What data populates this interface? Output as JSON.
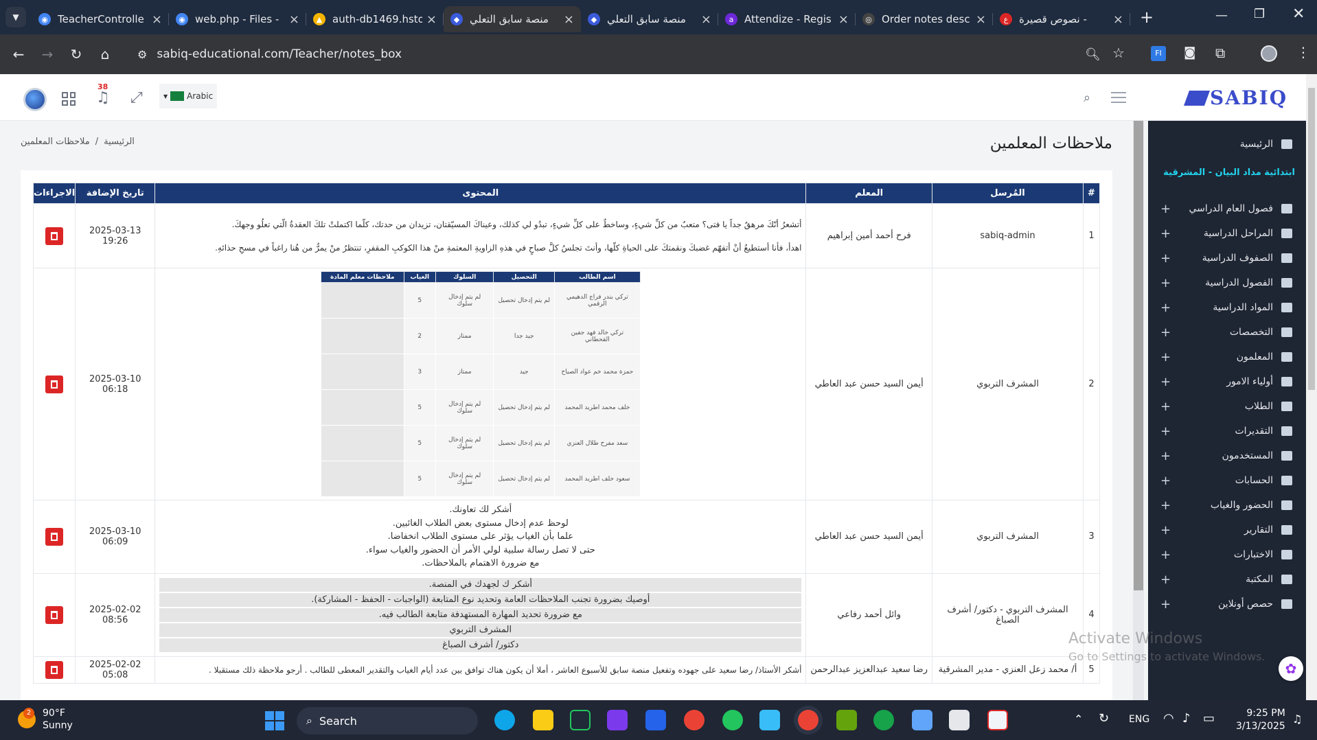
{
  "browser": {
    "tabs": [
      {
        "title": "TeacherControlle",
        "color": "#4285f4",
        "glyph": "◉"
      },
      {
        "title": "web.php - Files -",
        "color": "#4285f4",
        "glyph": "◉"
      },
      {
        "title": "auth-db1469.hsto",
        "color": "#f4b400",
        "glyph": "▲"
      },
      {
        "title": "منصة سابق التعلي",
        "color": "#3b5bdb",
        "glyph": "◆",
        "active": true
      },
      {
        "title": "منصة سابق التعلي",
        "color": "#3b5bdb",
        "glyph": "◆"
      },
      {
        "title": "Attendize - Regis",
        "color": "#6d28d9",
        "glyph": "a"
      },
      {
        "title": "Order notes desc",
        "color": "#444",
        "glyph": "◎"
      },
      {
        "title": "نصوص قصيرة -",
        "color": "#dc2626",
        "glyph": "ع"
      }
    ],
    "url": "sabiq-educational.com/Teacher/notes_box"
  },
  "header": {
    "notif_count": "38",
    "lang": "Arabic",
    "logo": "SABIQ"
  },
  "breadcrumb": {
    "home": "الرئيسية",
    "sep": "/",
    "current": "ملاحظات المعلمين"
  },
  "page_title": "ملاحظات المعلمين",
  "sidebar": {
    "home": "الرئيسية",
    "school": "ابتدائية مداد البيان - المشرقية",
    "items": [
      "فصول العام الدراسي",
      "المراحل الدراسية",
      "الصفوف الدراسية",
      "الفصول الدراسية",
      "المواد الدراسية",
      "التخصصات",
      "المعلمون",
      "أولياء الامور",
      "الطلاب",
      "التقديرات",
      "المستخدمون",
      "الحسابات",
      "الحضور والغياب",
      "التقارير",
      "الاختبارات",
      "المكتبة",
      "حصص أونلاين"
    ]
  },
  "table": {
    "headers": {
      "num": "#",
      "sender": "المُرسل",
      "teacher": "المعلم",
      "content": "المحتوى",
      "date": "تاريخ الإضافة",
      "actions": "الاجراءات"
    },
    "rows": [
      {
        "num": "1",
        "sender": "sabiq-admin",
        "teacher": "فرح أحمد أمين إبراهيم",
        "content_lines": [
          "أتشعرُ أنّكَ مرهقٌ جداً يا فتى؟ متعبٌ من كلِّ شيءٍ، وساخطٌ على كلِّ شيءٍ، تبدُو لي كذلك، وعيناكَ المسيّقتان، تزيدان من حدتك، كلّما اكتملتْ تلكَ العقدةُ الّتي تعلُو وجهكَ.",
          "اهدأ، فأنا أستطيعُ أنْ أتفهّم غضبكَ ونقمتكَ على الحياةِ كلّها، وأنتَ تجلسُ كلَّ صباحٍ في هذهِ الزاويةِ المعتمةِ منْ هذا الكوكبِ المقفرِ، تنتظرُ منْ يمرُّ من هُنا راغباً في مسحِ حذائهِ."
        ],
        "date": "2025-03-13 19:26"
      },
      {
        "num": "2",
        "sender": "المشرف التربوي",
        "teacher": "أيمن السيد حسن عبد العاطي",
        "mini_headers": [
          "اسم الطالب",
          "التحصيل",
          "السلوك",
          "الغياب",
          "ملاحظات معلم المادة"
        ],
        "mini_rows": [
          [
            "تركي بندر فراج الدهيمي الرقمي",
            "لم يتم إدخال تحصيل",
            "لم يتم إدخال سلوك",
            "5"
          ],
          [
            "تركي خالد فهد جفين القحطاني",
            "جيد جدا",
            "ممتاز",
            "2"
          ],
          [
            "حمزة محمد خم عواد الصياح",
            "جيد",
            "ممتاز",
            "3"
          ],
          [
            "خلف محمد اطريد المحمد",
            "لم يتم إدخال تحصيل",
            "لم يتم إدخال سلوك",
            "5"
          ],
          [
            "سعد مفرح طلال العنزي",
            "لم يتم إدخال تحصيل",
            "لم يتم إدخال سلوك",
            "5"
          ],
          [
            "سعود خلف اطريد المحمد",
            "لم يتم إدخال تحصيل",
            "لم يتم إدخال سلوك",
            "5"
          ]
        ],
        "date": "2025-03-10 06:18"
      },
      {
        "num": "3",
        "sender": "المشرف التربوي",
        "teacher": "أيمن السيد حسن عبد العاطي",
        "content_lines": [
          "أشكر لك تعاونك.",
          "لوحظ عدم إدخال مستوى بعض الطلاب الغائبين.",
          "علما بأن الغياب يؤثر على مستوى الطلاب انخفاضا.",
          "حتى لا تصل رسالة سلبية لولي الأمر أن الحضور والغياب سواء.",
          "مع ضرورة الاهتمام بالملاحظات."
        ],
        "date": "2025-03-10 06:09"
      },
      {
        "num": "4",
        "sender": "المشرف التربوي - دكتور/ أشرف الصباغ",
        "teacher": "وائل أحمد رفاعي",
        "content_lines": [
          "أشكر ك لجهدك في المنصة.",
          "أوصيك بضرورة تجنب الملاحظات العامة وتحديد نوع المتابعة (الواجبات - الحفظ - المشاركة).",
          "مع ضرورة تحديد المهارة المستهدفة متابعة الطالب فيه.",
          "المشرف التربوي",
          "دكتور/ أشرف الصباغ"
        ],
        "date": "2025-02-02 08:56"
      },
      {
        "num": "5",
        "sender": "أ/ محمد زعل العنزي - مدير المشرقية",
        "teacher": "رضا سعيد عبدالعزيز عبدالرحمن",
        "content_lines": [
          "أشكر الأستاذ/ رضا سعيد على جهوده وتفعيل منصة سابق للأسبوع العاشر ، أملا أن يكون هناك توافق بين عدد أيام الغياب والتقدير المعطى للطالب . أرجو ملاحظة ذلك مستقبلا ."
        ],
        "date": "2025-02-02 05:08"
      }
    ]
  },
  "watermark": {
    "line1": "Activate Windows",
    "line2": "Go to Settings to activate Windows."
  },
  "taskbar": {
    "weather_temp": "90°F",
    "weather_desc": "Sunny",
    "weather_badge": "2",
    "search": "Search",
    "lang": "ENG",
    "time": "9:25 PM",
    "date": "3/13/2025"
  }
}
